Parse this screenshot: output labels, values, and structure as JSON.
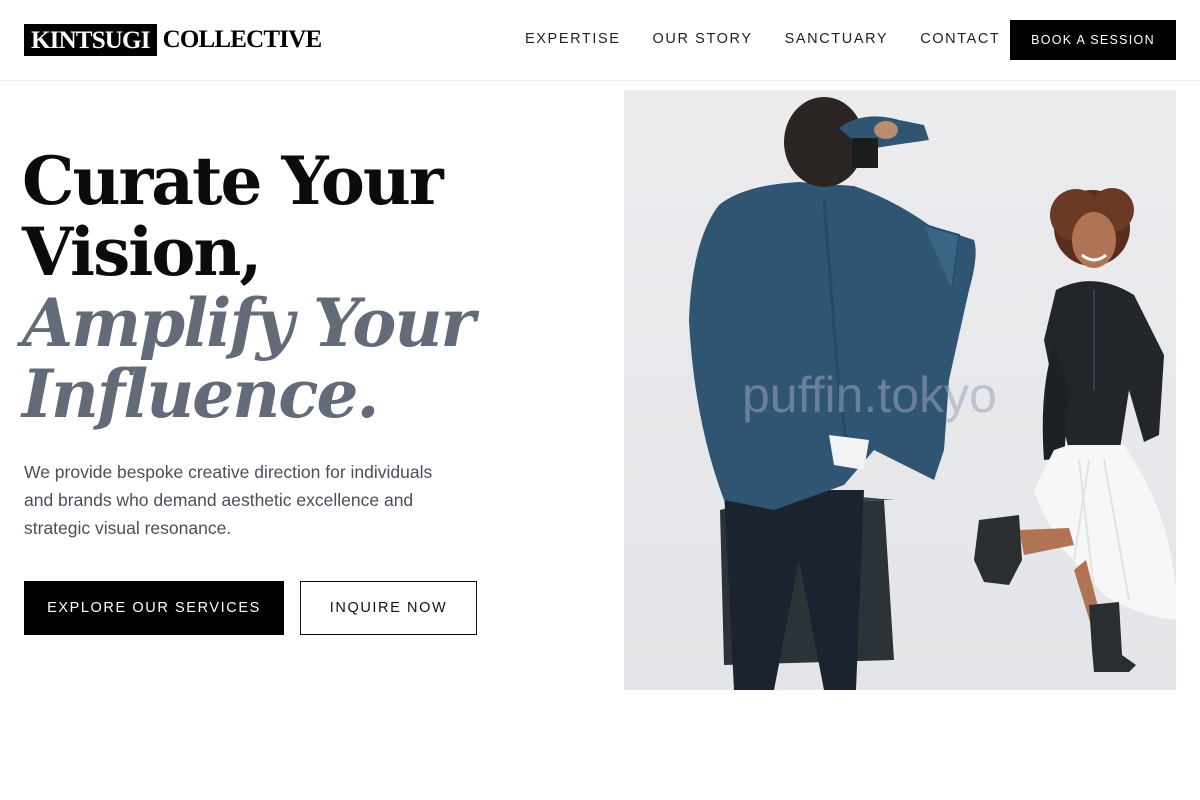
{
  "brand": {
    "name_box": "KINTSUGI",
    "name_rest": "COLLECTIVE"
  },
  "nav": {
    "items": [
      {
        "label": "EXPERTISE"
      },
      {
        "label": "OUR STORY"
      },
      {
        "label": "SANCTUARY"
      },
      {
        "label": "CONTACT"
      }
    ],
    "cta_label": "BOOK A SESSION"
  },
  "hero": {
    "headline_line1": "Curate Your",
    "headline_line2": "Vision,",
    "headline_accent_line1": "Amplify Your",
    "headline_accent_line2": "Influence.",
    "description": "We provide bespoke creative direction for individuals and brands who demand aesthetic excellence and strategic visual resonance.",
    "primary_button": "EXPLORE OUR SERVICES",
    "secondary_button": "INQUIRE NOW",
    "image": {
      "subject": "photographer photographing a smiling woman in a leather jacket and white skirt",
      "watermark": "puffin.tokyo"
    }
  },
  "colors": {
    "background": "#ffffff",
    "text": "#0b0b0b",
    "accent": "#646b78",
    "button": "#000000",
    "body_text": "#4a4f58"
  }
}
